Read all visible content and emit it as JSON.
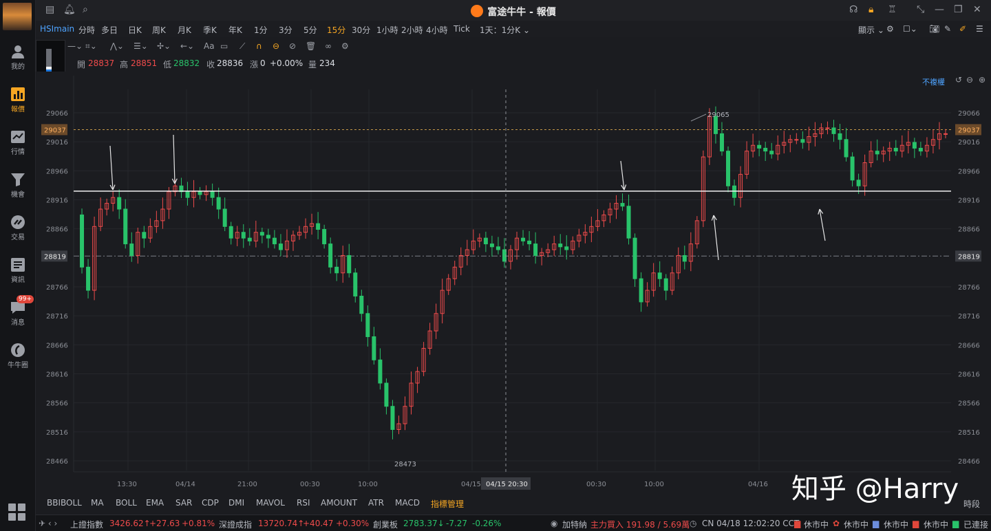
{
  "app": {
    "title": "富途牛牛 - 報價"
  },
  "sidebar": {
    "items": [
      {
        "label": "我的",
        "icon": "user-icon"
      },
      {
        "label": "報價",
        "icon": "bar-chart-icon",
        "active": true
      },
      {
        "label": "行情",
        "icon": "trend-icon"
      },
      {
        "label": "機會",
        "icon": "funnel-icon"
      },
      {
        "label": "交易",
        "icon": "trade-icon"
      },
      {
        "label": "資訊",
        "icon": "news-icon"
      },
      {
        "label": "消息",
        "icon": "message-icon",
        "badge": "99+"
      },
      {
        "label": "牛牛圈",
        "icon": "community-icon"
      }
    ]
  },
  "symbol": "HSImain",
  "timeframes": [
    "分時",
    "多日",
    "日K",
    "周K",
    "月K",
    "季K",
    "年K",
    "1分",
    "3分",
    "5分",
    "15分",
    "30分",
    "1小時",
    "2小時",
    "4小時",
    "Tick",
    "1天：1分K"
  ],
  "active_timeframe": "15分",
  "toolbar_right": {
    "display_label": "顯示"
  },
  "ohlc": {
    "open_label": "開",
    "open": "28837",
    "high_label": "高",
    "high": "28851",
    "low_label": "低",
    "low": "28832",
    "close_label": "收",
    "close": "28836",
    "change_label": "漲",
    "change": "0",
    "change_pct": "+0.00%",
    "volume_label": "量",
    "volume": "234"
  },
  "chart_controls": {
    "reweight_label": "不複權"
  },
  "chart_data": {
    "type": "candlestick",
    "y_ticks": [
      "29066",
      "29016",
      "28966",
      "28916",
      "28866",
      "28766",
      "28716",
      "28666",
      "28616",
      "28566",
      "28516",
      "28466"
    ],
    "ylim": [
      28450,
      29085
    ],
    "x_ticks": [
      "13:30",
      "04/14",
      "21:00",
      "00:30",
      "10:00",
      "04/15",
      "00:30",
      "10:00",
      "04/16"
    ],
    "crosshair_x_label": "04/15 20:30",
    "price_markers": {
      "upper": "29037",
      "lower": "28819"
    },
    "annotations": {
      "high_label": "29065",
      "low_label": "28473"
    },
    "horizontal_line": 28931,
    "up_color": "#ef4b4b",
    "down_color": "#29c36a"
  },
  "indicators": {
    "items": [
      "BBIBOLL",
      "MA",
      "BOLL",
      "EMA",
      "SAR",
      "CDP",
      "DMI",
      "MAVOL",
      "RSI",
      "AMOUNT",
      "ATR",
      "MACD",
      "指標管理"
    ],
    "time_label": "時段"
  },
  "status": {
    "sh_label": "上證指數",
    "sh_value": "3426.62↑",
    "sh_change": "+27.63",
    "sh_pct": "+0.81%",
    "sz_label": "深證成指",
    "sz_value": "13720.74↑",
    "sz_change": "+40.47",
    "sz_pct": "+0.30%",
    "cy_label": "創業板",
    "cy_value": "2783.37↓",
    "cy_change": "-7.27",
    "cy_pct": "-0.26%",
    "news_label": "加特納",
    "news_text": "主力買入 191.98 / 5.69萬",
    "time": "CN 04/18 12:02:20 CCT",
    "market1": "休市中",
    "market2": "休市中",
    "market3": "休市中",
    "market4": "休市中",
    "connection": "已連接"
  },
  "watermark": "知乎 @Harry"
}
